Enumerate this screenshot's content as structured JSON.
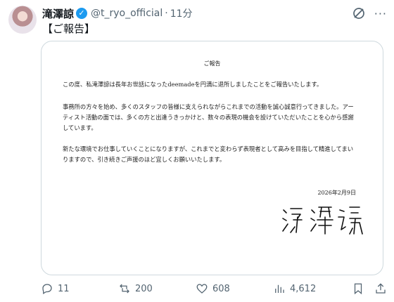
{
  "author": {
    "name": "滝澤諒",
    "verified_glyph": "✓",
    "handle": "@t_ryo_official",
    "separator": "·",
    "time": "11分"
  },
  "header_icons": [
    "grok-icon",
    "more-icon"
  ],
  "more_glyph": "···",
  "tweet": {
    "text": "【ご報告】"
  },
  "document": {
    "title": "ご報告",
    "paragraphs": [
      "この度、私滝澤諒は長年お世話になったdeemadeを円満に退所しましたことをご報告いたします。",
      "事務所の方々を始め、多くのスタッフの皆様に支えられながらこれまでの活動を誠心誠意行ってきました。アーティスト活動の面では、多くの方と出逢うきっかけと、数々の表現の機会を設けていただいたことを心から感謝しています。",
      "新たな環境でお仕事していくことになりますが、これまでと変わらず表現者として高みを目指して精進してまいりますので、引き続きご声援のほど宜しくお願いいたします。"
    ],
    "date": "2026年2月9日",
    "signature": "滝澤 諒"
  },
  "actions": {
    "reply_count": "11",
    "retweet_count": "200",
    "like_count": "608",
    "view_count": "4,612"
  },
  "colors": {
    "verified": "#1d9bf0",
    "muted": "#536471",
    "border": "#cfd9de"
  }
}
